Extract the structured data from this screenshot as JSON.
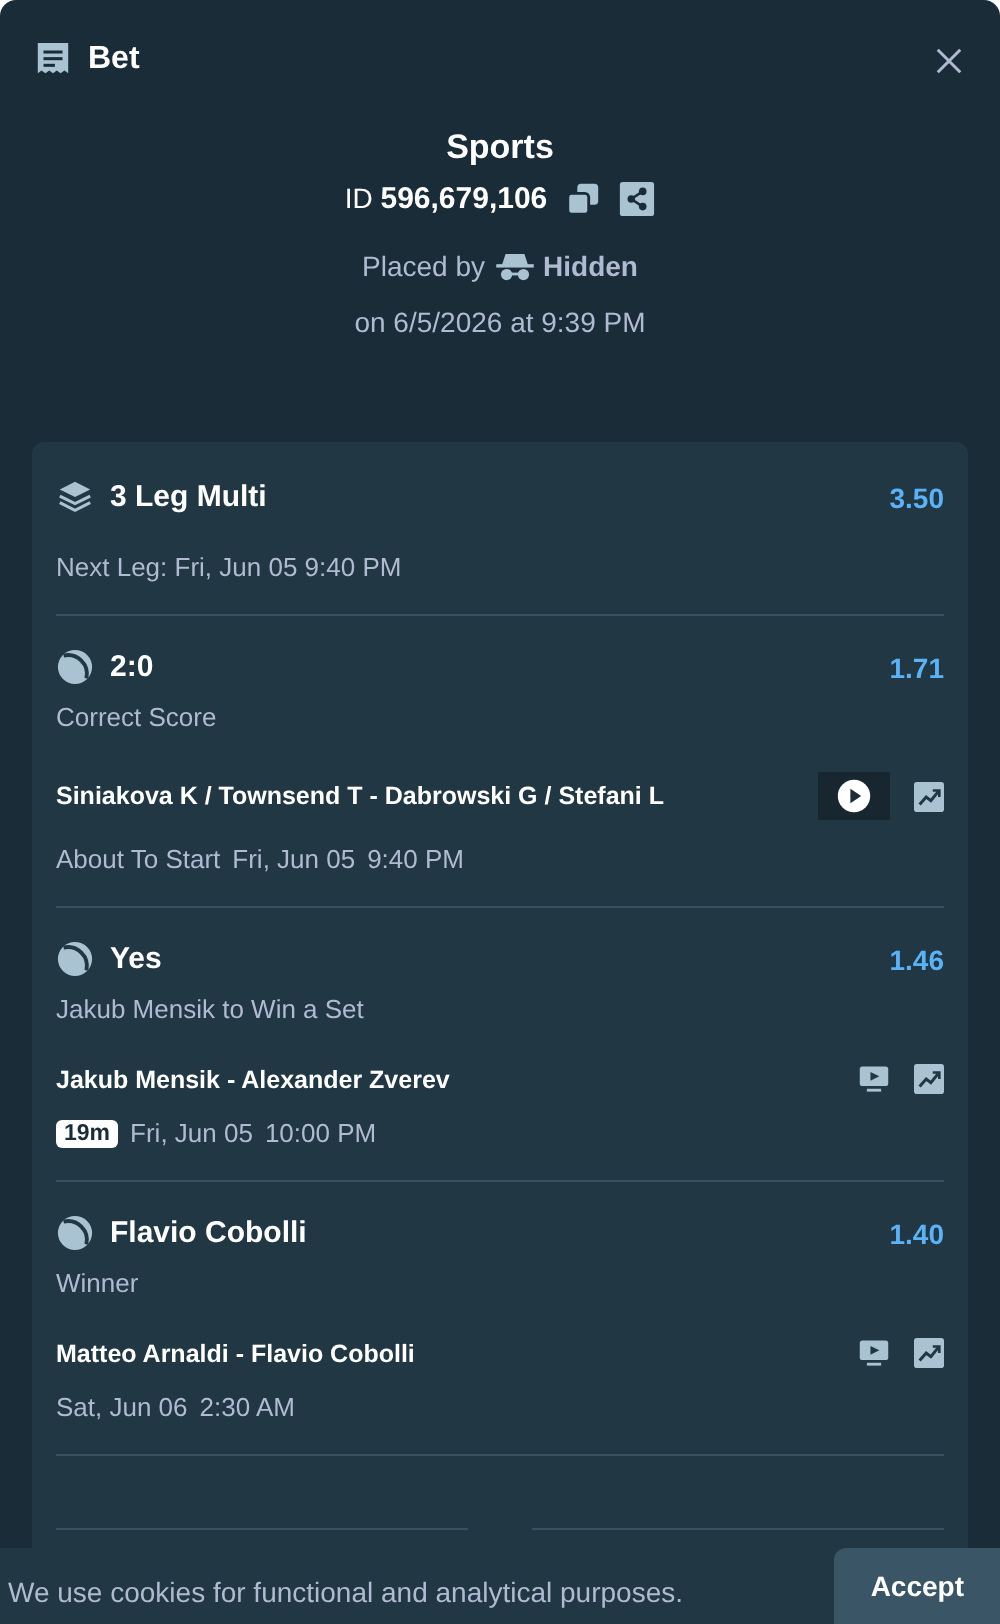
{
  "header": {
    "title": "Bet"
  },
  "summary": {
    "category": "Sports",
    "id_label": "ID",
    "id_value": "596,679,106",
    "placed_by_label": "Placed by",
    "placed_by_user": "Hidden",
    "placed_on": "on 6/5/2026 at 9:39 PM"
  },
  "multi": {
    "title": "3 Leg Multi",
    "odds": "3.50",
    "next_leg": "Next Leg: Fri, Jun 05 9:40 PM"
  },
  "legs": [
    {
      "selection": "2:0",
      "odds": "1.71",
      "market": "Correct Score",
      "match": "Siniakova K / Townsend T - Dabrowski G / Stefani L",
      "kind": "play",
      "status": "About To Start",
      "date": "Fri, Jun 05",
      "time": "9:40 PM"
    },
    {
      "selection": "Yes",
      "odds": "1.46",
      "market": "Jakub Mensik to Win a Set",
      "match": "Jakub Mensik - Alexander Zverev",
      "kind": "tv",
      "badge": "19m",
      "date": "Fri, Jun 05",
      "time": "10:00 PM"
    },
    {
      "selection": "Flavio Cobolli",
      "odds": "1.40",
      "market": "Winner",
      "match": "Matteo Arnaldi - Flavio Cobolli",
      "kind": "tv",
      "date": "Sat, Jun 06",
      "time": "2:30 AM"
    }
  ],
  "cookie_banner": {
    "message": "We use cookies for functional and analytical purposes.",
    "button": "Accept"
  }
}
